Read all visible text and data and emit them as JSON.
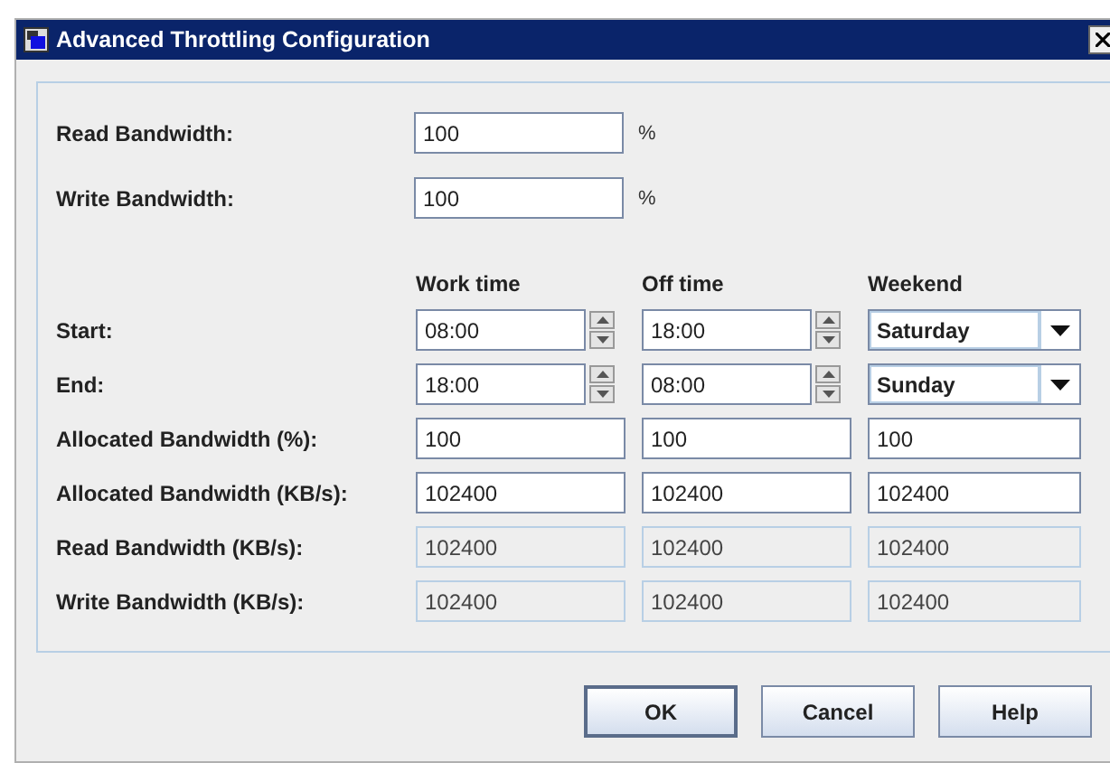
{
  "window": {
    "title": "Advanced Throttling Configuration"
  },
  "percent_fields": [
    {
      "label": "Read Bandwidth:",
      "value": "100",
      "unit": "%"
    },
    {
      "label": "Write Bandwidth:",
      "value": "100",
      "unit": "%"
    }
  ],
  "schedule": {
    "columns": [
      "Work time",
      "Off time",
      "Weekend"
    ],
    "rows": [
      {
        "label": "Start:",
        "cells": [
          {
            "kind": "spinner",
            "value": "08:00",
            "disabled": false
          },
          {
            "kind": "spinner",
            "value": "18:00",
            "disabled": false
          },
          {
            "kind": "dropdown",
            "value": "Saturday",
            "disabled": false
          }
        ]
      },
      {
        "label": "End:",
        "cells": [
          {
            "kind": "spinner",
            "value": "18:00",
            "disabled": false
          },
          {
            "kind": "spinner",
            "value": "08:00",
            "disabled": false
          },
          {
            "kind": "dropdown",
            "value": "Sunday",
            "disabled": false
          }
        ]
      },
      {
        "label": "Allocated Bandwidth (%):",
        "cells": [
          {
            "kind": "text",
            "value": "100",
            "disabled": false
          },
          {
            "kind": "text",
            "value": "100",
            "disabled": false
          },
          {
            "kind": "text",
            "value": "100",
            "disabled": false
          }
        ]
      },
      {
        "label": "Allocated Bandwidth (KB/s):",
        "cells": [
          {
            "kind": "text",
            "value": "102400",
            "disabled": false
          },
          {
            "kind": "text",
            "value": "102400",
            "disabled": false
          },
          {
            "kind": "text",
            "value": "102400",
            "disabled": false
          }
        ]
      },
      {
        "label": "Read Bandwidth (KB/s):",
        "cells": [
          {
            "kind": "text",
            "value": "102400",
            "disabled": true
          },
          {
            "kind": "text",
            "value": "102400",
            "disabled": true
          },
          {
            "kind": "text",
            "value": "102400",
            "disabled": true
          }
        ]
      },
      {
        "label": "Write Bandwidth (KB/s):",
        "cells": [
          {
            "kind": "text",
            "value": "102400",
            "disabled": true
          },
          {
            "kind": "text",
            "value": "102400",
            "disabled": true
          },
          {
            "kind": "text",
            "value": "102400",
            "disabled": true
          }
        ]
      }
    ]
  },
  "buttons": [
    {
      "label": "OK",
      "default": true
    },
    {
      "label": "Cancel",
      "default": false
    },
    {
      "label": "Help",
      "default": false
    }
  ]
}
